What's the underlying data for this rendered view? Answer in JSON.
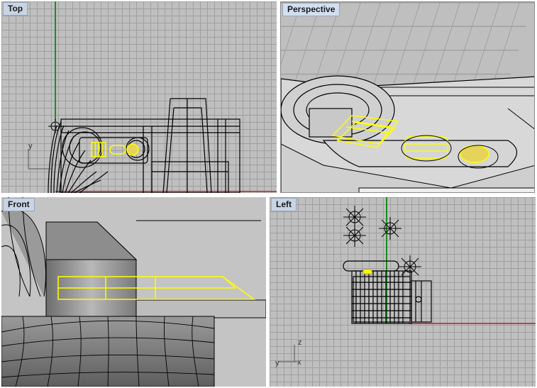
{
  "viewports": {
    "top": {
      "label": "Top",
      "axes": {
        "y": "y"
      }
    },
    "perspective": {
      "label": "Perspective"
    },
    "front": {
      "label": "Front"
    },
    "left": {
      "label": "Left",
      "axes": {
        "z": "z",
        "y": "y",
        "x": "x"
      }
    }
  },
  "colors": {
    "selection": "#ffff00",
    "x_axis": "#b22222",
    "y_axis": "#1e8c1e",
    "wire": "#000000",
    "grid": "#9f9f9f",
    "background": "#bfbfbf"
  }
}
